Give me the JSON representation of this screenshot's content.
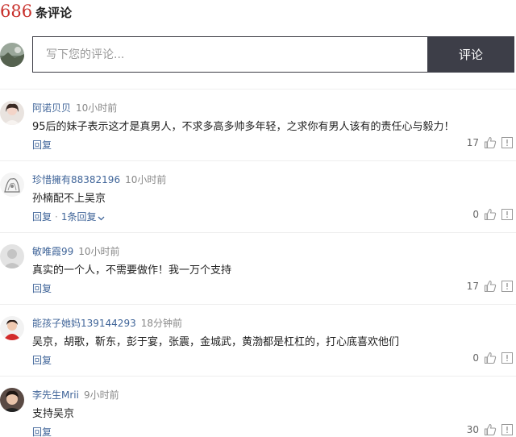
{
  "header": {
    "count": "686",
    "label": "条评论"
  },
  "composer": {
    "placeholder": "写下您的评论...",
    "submit_label": "评论"
  },
  "comments": [
    {
      "user": "阿诺贝贝",
      "time": "10小时前",
      "text": "95后的妹子表示这才是真男人，不求多高多帅多年轻，之求你有男人该有的责任心与毅力！",
      "reply": "回复",
      "replies": "",
      "likes": "17"
    },
    {
      "user": "珍惜擁有88382196",
      "time": "10小时前",
      "text": "孙楠配不上吴京",
      "reply": "回复",
      "replies": "1条回复",
      "likes": "0"
    },
    {
      "user": "敏唯霞99",
      "time": "10小时前",
      "text": "真实的一个人，不需要做作！我一万个支持",
      "reply": "回复",
      "replies": "",
      "likes": "17"
    },
    {
      "user": "能孩子她妈139144293",
      "time": "18分钟前",
      "text": "吴京，胡歌，靳东，彭于宴，张震，金城武，黄渤都是杠杠的，打心底喜欢他们",
      "reply": "回复",
      "replies": "",
      "likes": "0"
    },
    {
      "user": "李先生Mrii",
      "time": "9小时前",
      "text": "支持吴京",
      "reply": "回复",
      "replies": "",
      "likes": "30"
    }
  ]
}
